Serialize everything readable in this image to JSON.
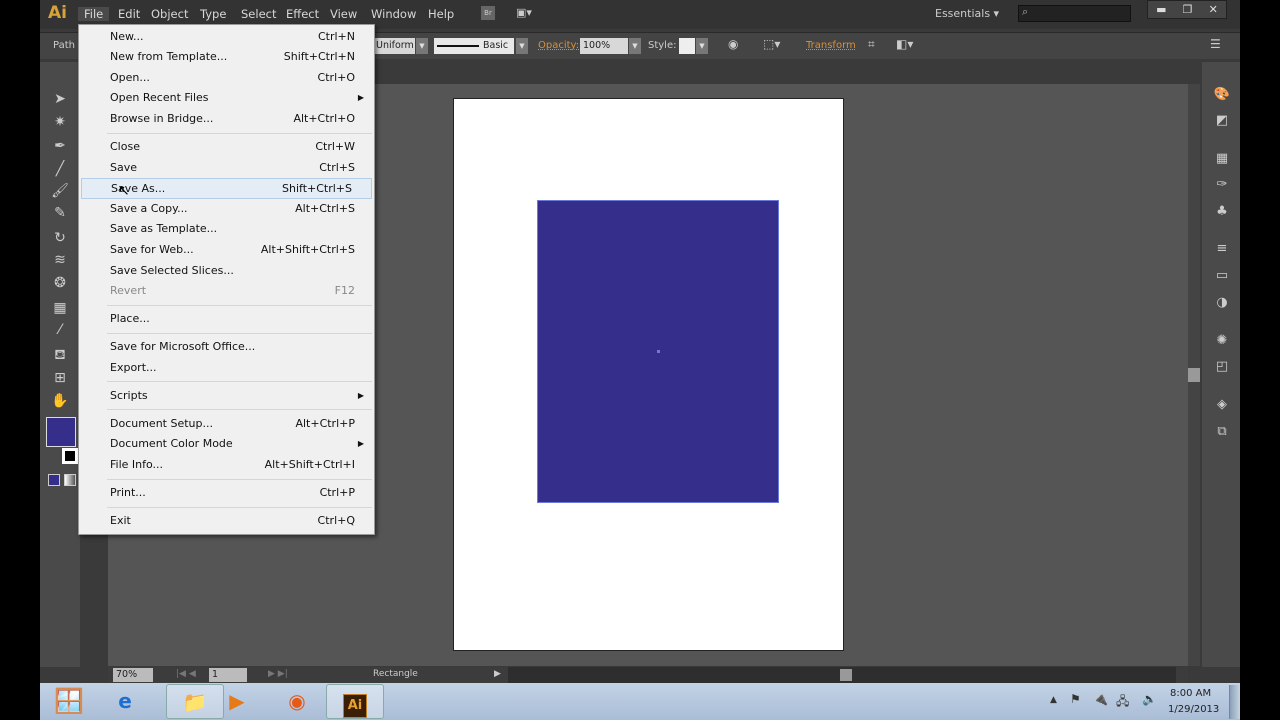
{
  "app": {
    "logo": "Ai",
    "menus": [
      "File",
      "Edit",
      "Object",
      "Type",
      "Select",
      "Effect",
      "View",
      "Window",
      "Help"
    ],
    "bridge": "Br",
    "workspace": "Essentials",
    "search_placeholder": ""
  },
  "control_bar": {
    "object_type": "Path",
    "stroke_profile": "Uniform",
    "brush": "Basic",
    "opacity_label": "Opacity:",
    "opacity_value": "100%",
    "style_label": "Style:",
    "transform_label": "Transform"
  },
  "colors": {
    "fill": "#352e8a",
    "accent_orange": "#d8a23a"
  },
  "file_menu": [
    {
      "label": "New...",
      "shortcut": "Ctrl+N"
    },
    {
      "label": "New from Template...",
      "shortcut": "Shift+Ctrl+N"
    },
    {
      "label": "Open...",
      "shortcut": "Ctrl+O"
    },
    {
      "label": "Open Recent Files",
      "submenu": true
    },
    {
      "label": "Browse in Bridge...",
      "shortcut": "Alt+Ctrl+O"
    },
    {
      "sep": true
    },
    {
      "label": "Close",
      "shortcut": "Ctrl+W"
    },
    {
      "label": "Save",
      "shortcut": "Ctrl+S"
    },
    {
      "label": "Save As...",
      "shortcut": "Shift+Ctrl+S",
      "highlighted": true
    },
    {
      "label": "Save a Copy...",
      "shortcut": "Alt+Ctrl+S"
    },
    {
      "label": "Save as Template..."
    },
    {
      "label": "Save for Web...",
      "shortcut": "Alt+Shift+Ctrl+S"
    },
    {
      "label": "Save Selected Slices..."
    },
    {
      "label": "Revert",
      "shortcut": "F12",
      "disabled": true
    },
    {
      "sep": true
    },
    {
      "label": "Place..."
    },
    {
      "sep": true
    },
    {
      "label": "Save for Microsoft Office..."
    },
    {
      "label": "Export..."
    },
    {
      "sep": true
    },
    {
      "label": "Scripts",
      "submenu": true
    },
    {
      "sep": true
    },
    {
      "label": "Document Setup...",
      "shortcut": "Alt+Ctrl+P"
    },
    {
      "label": "Document Color Mode",
      "submenu": true
    },
    {
      "label": "File Info...",
      "shortcut": "Alt+Shift+Ctrl+I"
    },
    {
      "sep": true
    },
    {
      "label": "Print...",
      "shortcut": "Ctrl+P"
    },
    {
      "sep": true
    },
    {
      "label": "Exit",
      "shortcut": "Ctrl+Q"
    }
  ],
  "status_bar": {
    "zoom": "70%",
    "artboard": "1",
    "tool": "Rectangle"
  },
  "taskbar": {
    "time": "8:00 AM",
    "date": "1/29/2013",
    "ai_label": "Ai"
  }
}
